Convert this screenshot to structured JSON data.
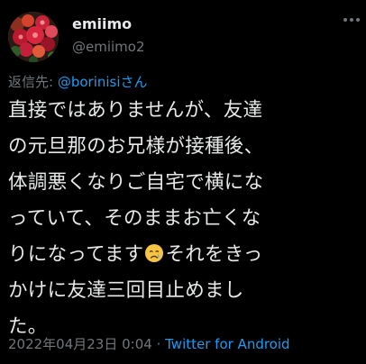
{
  "user": {
    "display_name": "emiimo",
    "handle": "@emiimo2",
    "avatar_icon": "rose-bouquet-avatar"
  },
  "reply": {
    "prefix": "返信先: ",
    "mention": "@borinisiさん"
  },
  "body": {
    "line1": "直接ではありませんが、友達",
    "line2": "の元旦那のお兄様が接種後、",
    "line3": "体調悪くなりご自宅で横にな",
    "line4": "っていて、そのままお亡くな",
    "line5a": "りになってます",
    "line5b": "それをきっ",
    "line6": "かけに友達三回目止めまし",
    "line7": "た。",
    "emoji_icon": "crying-face-emoji"
  },
  "meta": {
    "timestamp": "2022年04月23日 0:04",
    "separator": " · ",
    "source": "Twitter for Android"
  },
  "colors": {
    "background": "#000000",
    "text": "#e7e9ea",
    "muted": "#71767b",
    "link": "#1d9bf0"
  }
}
